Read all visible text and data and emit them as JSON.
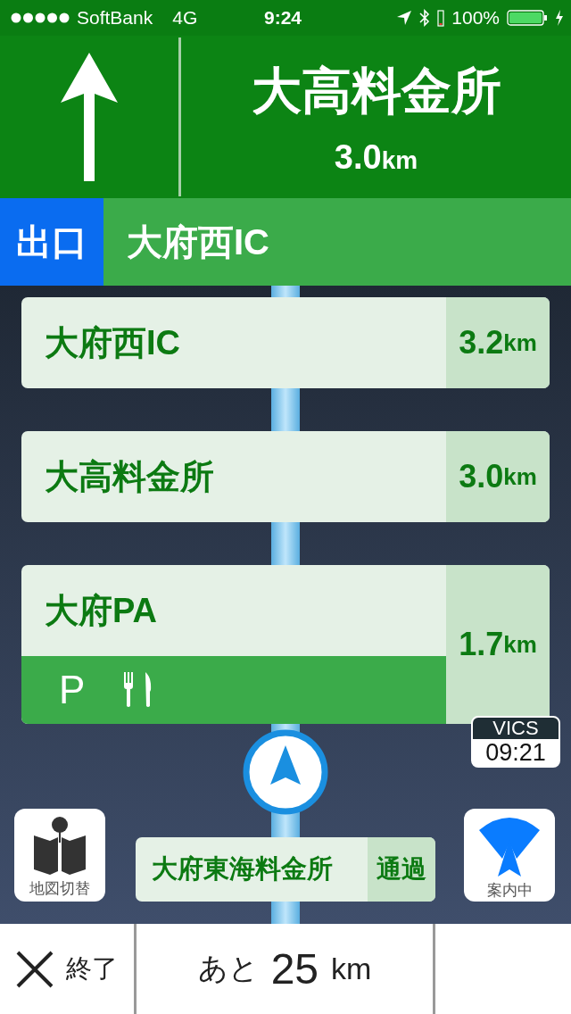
{
  "status_bar": {
    "carrier": "SoftBank",
    "network": "4G",
    "time": "9:24",
    "battery": "100%"
  },
  "next_turn": {
    "kind": "straight",
    "name": "大高料金所",
    "distance": "3.0",
    "unit": "km"
  },
  "exit_bar": {
    "badge": "出口",
    "name": "大府西IC"
  },
  "route_items": [
    {
      "kind": "plain",
      "name": "大府西IC",
      "distance": "3.2",
      "unit": "km"
    },
    {
      "kind": "plain",
      "name": "大高料金所",
      "distance": "3.0",
      "unit": "km"
    },
    {
      "kind": "service_area",
      "name": "大府PA",
      "distance": "1.7",
      "unit": "km",
      "facilities": [
        {
          "kind": "parking",
          "text": "P"
        },
        {
          "kind": "restaurant"
        }
      ]
    }
  ],
  "vics": {
    "label": "VICS",
    "time": "09:21"
  },
  "map_switch_button": {
    "label": "地図切替"
  },
  "passed": {
    "name": "大府東海料金所",
    "status": "通過"
  },
  "guidance_button": {
    "label": "案内中"
  },
  "bottom_bar": {
    "end_label": "終了",
    "remaining_prefix": "あと",
    "remaining": "25",
    "unit": "km"
  }
}
